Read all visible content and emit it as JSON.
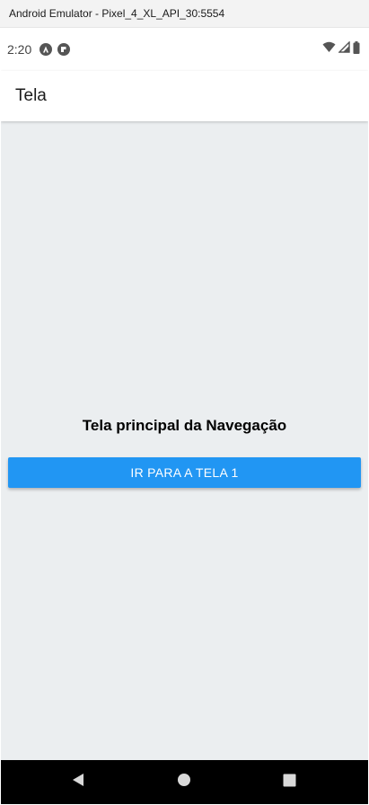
{
  "window": {
    "title": "Android Emulator - Pixel_4_XL_API_30:5554"
  },
  "status_bar": {
    "time": "2:20",
    "left_icons": [
      "react-native-icon",
      "debug-app-icon"
    ],
    "right_icons": [
      "wifi-icon",
      "cell-signal-icon",
      "battery-icon"
    ]
  },
  "app_bar": {
    "title": "Tela"
  },
  "main": {
    "heading": "Tela principal da Navegação",
    "button_label": "IR PARA A TELA 1"
  },
  "nav_bar": {
    "buttons": [
      "back-icon",
      "home-icon",
      "recents-icon"
    ]
  },
  "colors": {
    "accent": "#2196f3",
    "background": "#ebeef0",
    "app_bar": "#ffffff",
    "nav_bar": "#000000"
  }
}
